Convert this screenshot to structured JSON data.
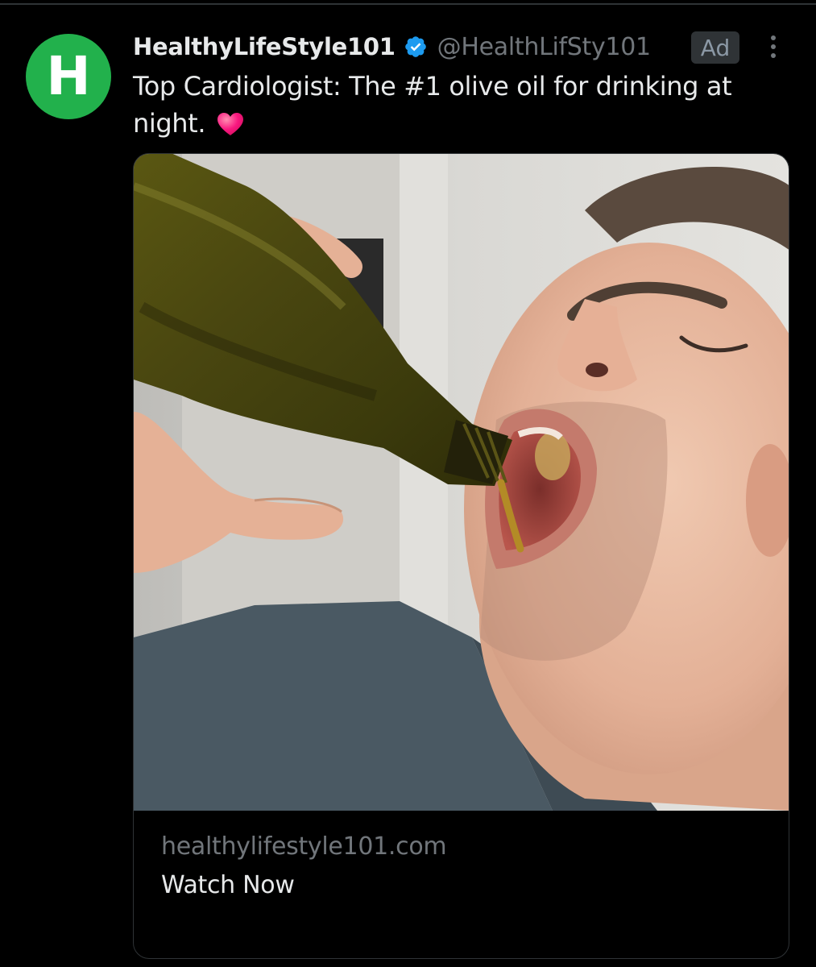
{
  "post": {
    "avatar_letter": "H",
    "display_name": "HealthyLifeStyle101",
    "handle": "@HealthLifSty101",
    "ad_label": "Ad",
    "text": "Top Cardiologist: The #1 olive oil for drinking at night.",
    "text_emoji": "heart-icon",
    "verified_icon": "verified-badge-icon",
    "more_icon": "more-options-icon"
  },
  "card": {
    "image_subject": "man-drinking-olive-oil-photo",
    "domain": "healthylifestyle101.com",
    "cta": "Watch Now"
  },
  "colors": {
    "background": "#000000",
    "avatar_bg": "#22b14c",
    "verified_blue": "#1d9bf0",
    "heart_pink": "#f91880",
    "muted_text": "#71767b",
    "primary_text": "#e7e9ea",
    "border": "#2f3336"
  }
}
